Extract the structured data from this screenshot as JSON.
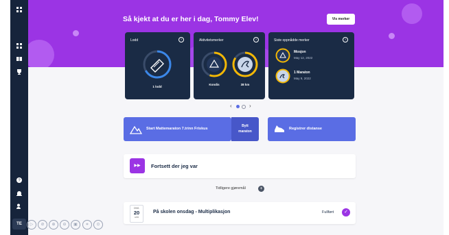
{
  "sidebar": {
    "avatar_initials": "TE",
    "top_icon": "grid-icon",
    "items": [
      {
        "icon": "grid-icon"
      },
      {
        "icon": "book-icon"
      },
      {
        "icon": "trophy-icon"
      }
    ],
    "bottom_items": [
      {
        "icon": "help-icon"
      },
      {
        "icon": "bell-icon"
      },
      {
        "icon": "users-icon"
      }
    ]
  },
  "header": {
    "greeting": "Så kjekt at du er her i dag, Tommy Elev!",
    "show_badges_button": "Vis merker"
  },
  "cards": {
    "lodd": {
      "title": "Lodd",
      "value_label": "1 lodd"
    },
    "activity": {
      "title": "Aktivitetsmerker",
      "badges": [
        {
          "label": "Kondis"
        },
        {
          "label": "38 km"
        }
      ]
    },
    "recent": {
      "title": "Siste oppnådde merker",
      "items": [
        {
          "name": "Mosjon",
          "date": "May 12, 2022"
        },
        {
          "name": "1 Maraton",
          "date": "May 9, 2022"
        }
      ]
    },
    "carousel": {
      "prev": "‹",
      "next": "›"
    }
  },
  "actions": {
    "start_marathon": "Start Mattemaraton 7.trinn Friskus",
    "switch_marathon_line1": "Bytt",
    "switch_marathon_line2": "maraton",
    "register_distance": "Registrer distanse"
  },
  "resume": {
    "label": "Fortsett der jeg var",
    "icon": "▶▶"
  },
  "previous_tasks": {
    "label": "Tidligere gjøremål",
    "add_icon": "+"
  },
  "task": {
    "date_month": "ONS.",
    "date_day": "20",
    "date_sub": "APR",
    "title": "På skolen onsdag - Multiplikasjon",
    "status": "Fullført",
    "status_icon": "✓"
  },
  "bottom_toolbar": [
    "▷",
    "⊘",
    "⊕",
    "⊖",
    "▣",
    "⌗",
    "⊙"
  ],
  "colors": {
    "purple": "#9b34e4",
    "navy": "#1a2b45",
    "sidebar": "#16243b",
    "action_blue": "#5a6de4",
    "ring_yellow": "#f2b705",
    "ring_blue": "#3b87e8"
  }
}
